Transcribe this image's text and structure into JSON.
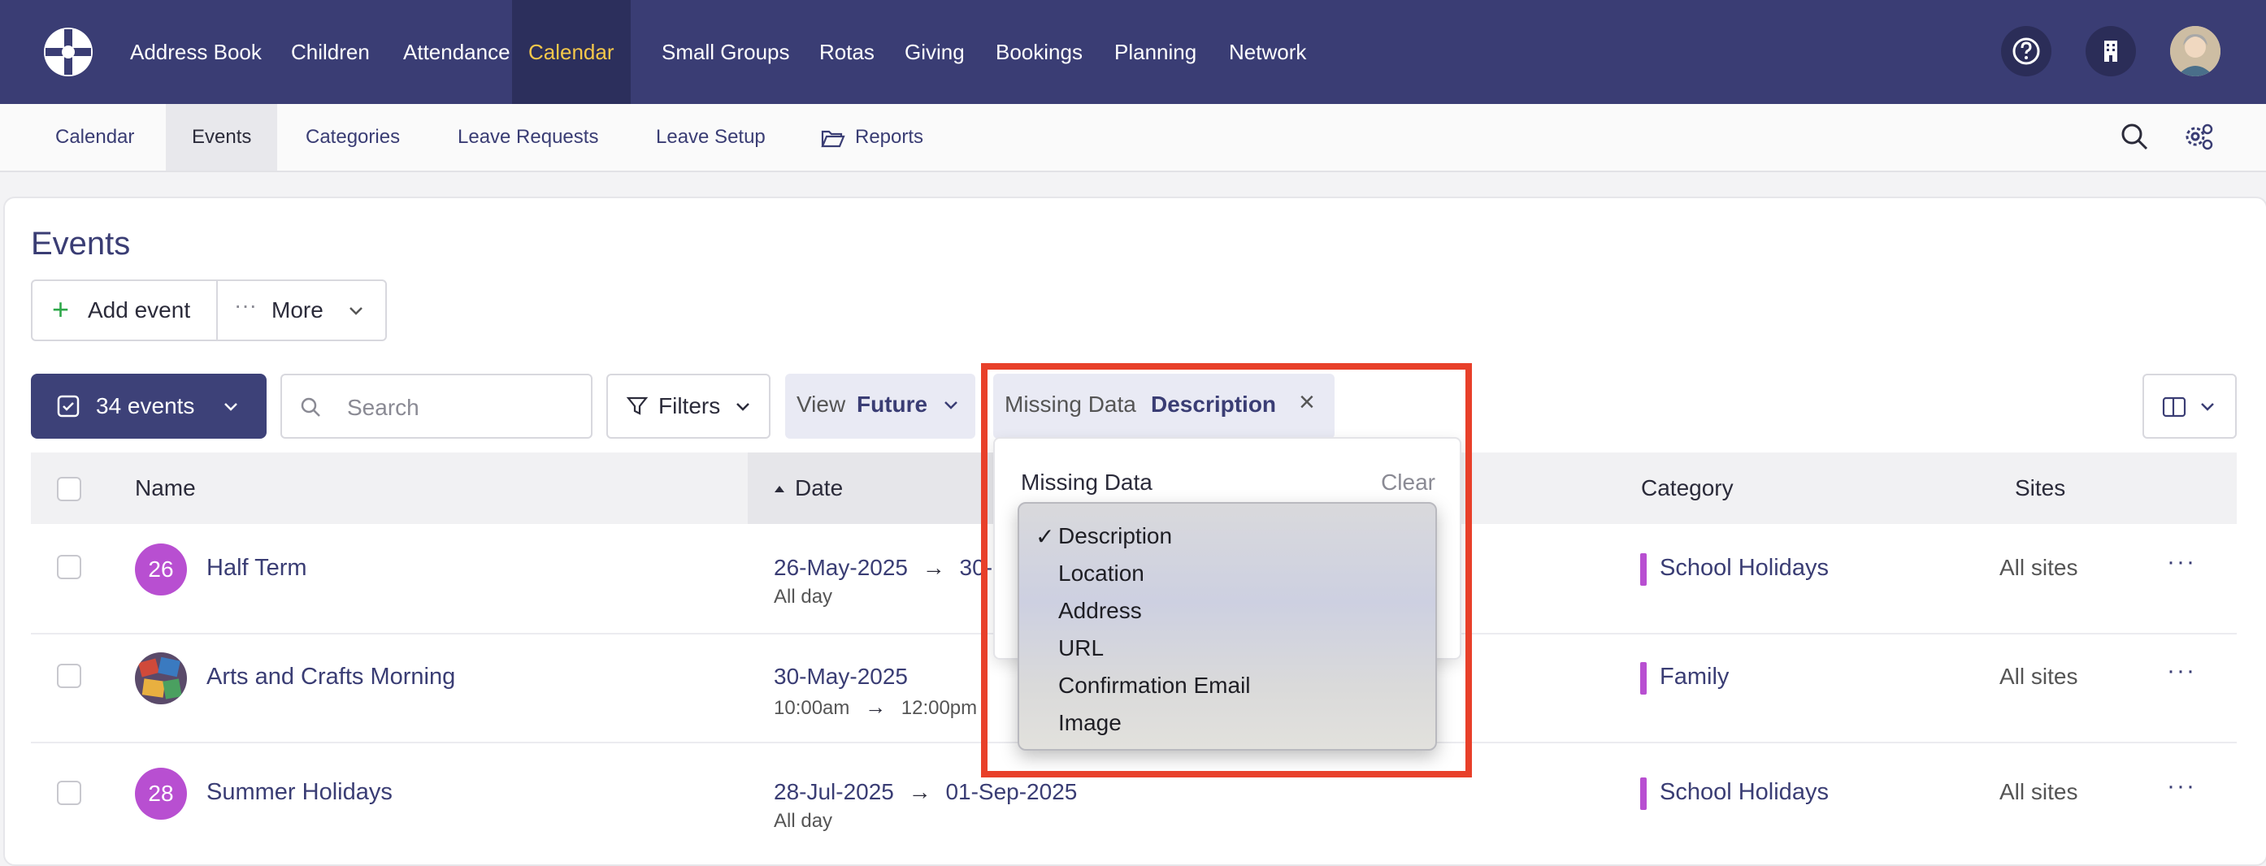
{
  "topnav": {
    "items": [
      "Address Book",
      "Children",
      "Attendance",
      "Calendar",
      "Small Groups",
      "Rotas",
      "Giving",
      "Bookings",
      "Planning",
      "Network"
    ],
    "active": "Calendar"
  },
  "subnav": {
    "items": [
      "Calendar",
      "Events",
      "Categories",
      "Leave Requests",
      "Leave Setup",
      "Reports"
    ],
    "active": "Events"
  },
  "page": {
    "title": "Events",
    "add_event_label": "Add event",
    "more_label": "More"
  },
  "toolbar": {
    "events_count_label": "34 events",
    "search_placeholder": "Search",
    "filters_label": "Filters",
    "view_label": "View",
    "view_value": "Future",
    "missing_label": "Missing Data",
    "missing_value": "Description",
    "remove_glyph": "×"
  },
  "table": {
    "columns": [
      "Name",
      "Date",
      "Category",
      "Sites"
    ],
    "rows": [
      {
        "badge": "26",
        "name": "Half Term",
        "date_start": "26-May-2025",
        "date_end": "30-",
        "sub": "All day",
        "category": "School Holidays",
        "sites": "All sites"
      },
      {
        "badge": "",
        "name": "Arts and Crafts Morning",
        "date_start": "30-May-2025",
        "date_end": "",
        "sub": "10:00am",
        "sub_end": "12:00pm",
        "category": "Family",
        "sites": "All sites"
      },
      {
        "badge": "28",
        "name": "Summer Holidays",
        "date_start": "28-Jul-2025",
        "date_end": "01-Sep-2025",
        "sub": "All day",
        "category": "School Holidays",
        "sites": "All sites"
      }
    ]
  },
  "popover": {
    "title": "Missing Data",
    "clear_label": "Clear"
  },
  "dropdown": {
    "options": [
      "Description",
      "Location",
      "Address",
      "URL",
      "Confirmation Email",
      "Image"
    ],
    "selected": "Description",
    "check_glyph": "✓"
  },
  "colors": {
    "topbar": "#3a3d74",
    "active_nav_text": "#f5c84a",
    "badge": "#b84fd1",
    "highlight": "#e8402a"
  }
}
